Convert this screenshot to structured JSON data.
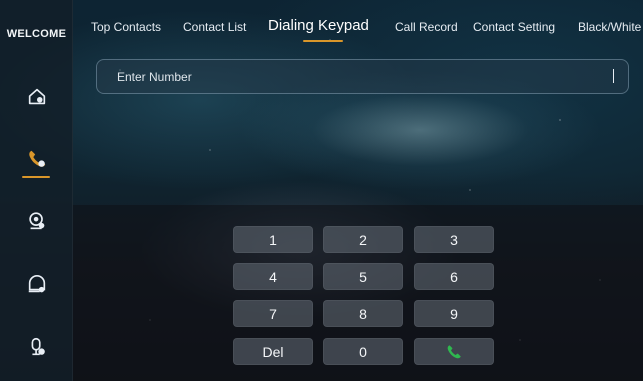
{
  "sidebar": {
    "welcome": "WELCOME",
    "items": [
      {
        "icon": "home-icon"
      },
      {
        "icon": "phone-icon",
        "active": true
      },
      {
        "icon": "camera-icon"
      },
      {
        "icon": "message-icon"
      },
      {
        "icon": "microphone-icon"
      }
    ]
  },
  "tabs": [
    {
      "label": "Top Contacts"
    },
    {
      "label": "Contact List"
    },
    {
      "label": "Dialing Keypad",
      "active": true
    },
    {
      "label": "Call Record"
    },
    {
      "label": "Contact Setting"
    },
    {
      "label": "Black/White"
    }
  ],
  "number_input": {
    "placeholder": "Enter Number",
    "value": "",
    "caret": "I"
  },
  "keypad": {
    "keys": [
      "1",
      "2",
      "3",
      "4",
      "5",
      "6",
      "7",
      "8",
      "9",
      "Del",
      "0"
    ],
    "call_icon": "call-icon"
  },
  "colors": {
    "accent": "#d9962a",
    "call_green": "#2fb84f"
  }
}
